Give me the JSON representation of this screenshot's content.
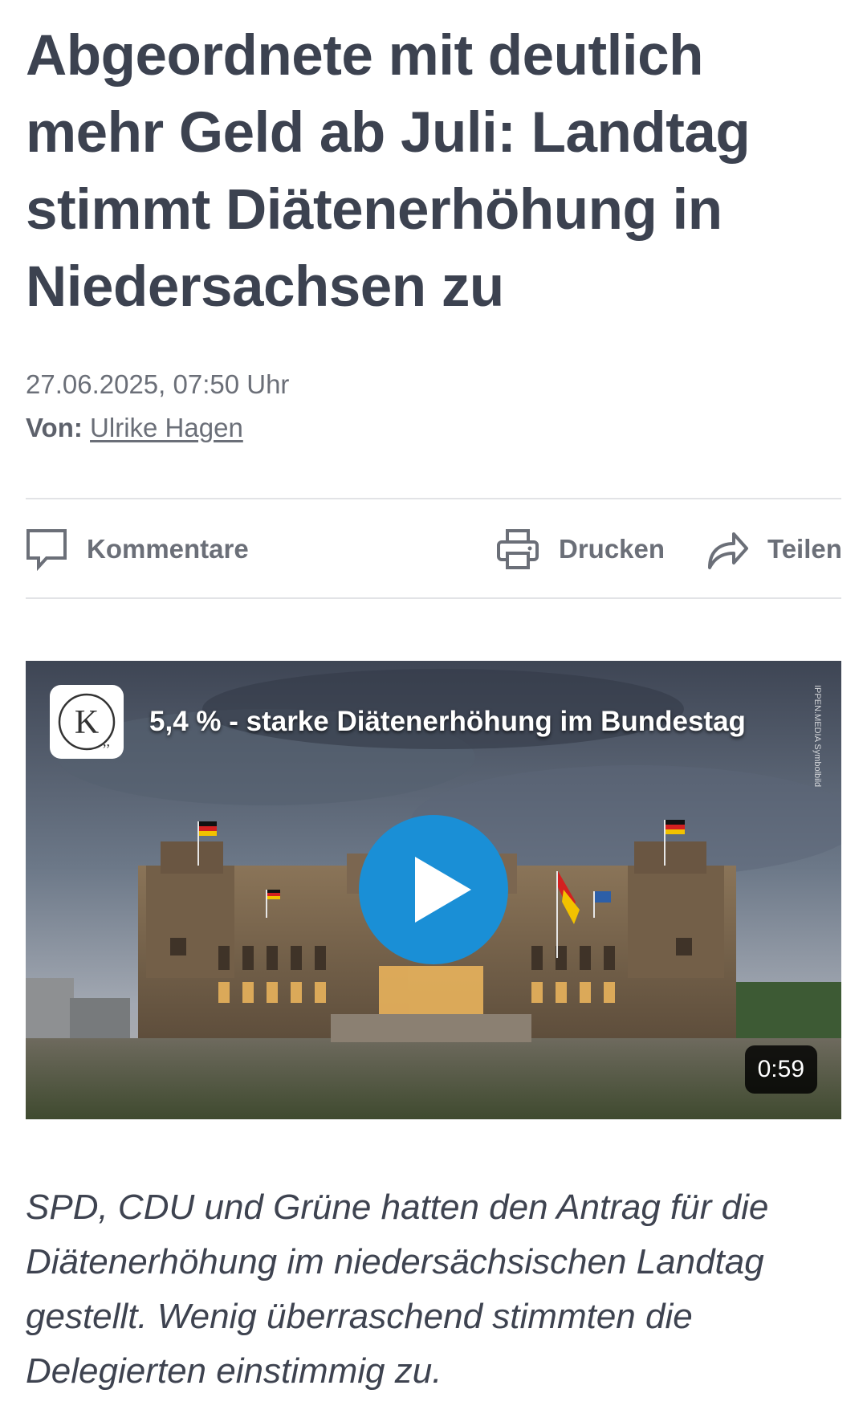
{
  "article": {
    "headline": "Abgeordnete mit deutlich mehr Geld ab Juli: Landtag stimmt Diätenerhöhung in Niedersachsen zu",
    "date": "27.06.2025, 07:50 Uhr",
    "author_prefix": "Von:",
    "author_name": "Ulrike Hagen",
    "lead": "SPD, CDU und Grüne hatten den Antrag für die Diätenerhöhung im niedersächsischen Landtag gestellt. Wenig überraschend stimmten die Delegierten einstimmig zu."
  },
  "actions": {
    "comments_label": "Kommentare",
    "print_label": "Drucken",
    "share_label": "Teilen"
  },
  "video": {
    "title": "5,4 % - starke Diätenerhöhung im Bundestag",
    "credit": "IPPEN.MEDIA Symbolbild",
    "duration": "0:59",
    "logo_letter": "K"
  },
  "icons": {
    "comments": "speech-bubble-icon",
    "print": "printer-icon",
    "share": "share-arrow-icon",
    "play": "play-icon"
  },
  "colors": {
    "text": "#3c4250",
    "muted": "#6b6f78",
    "play_button": "#1a8fd6"
  }
}
